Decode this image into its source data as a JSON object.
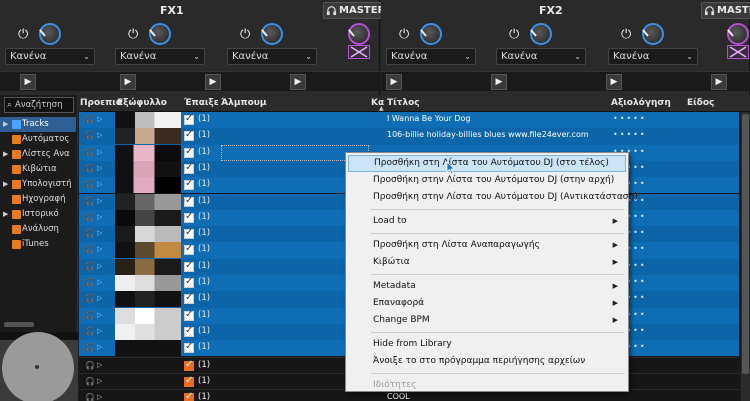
{
  "fx": [
    {
      "title": "FX1",
      "master_label": "MASTER",
      "slots": [
        {
          "effect": "Κανένα"
        },
        {
          "effect": "Κανένα"
        },
        {
          "effect": "Κανένα"
        }
      ]
    },
    {
      "title": "FX2",
      "master_label": "MASTER",
      "slots": [
        {
          "effect": "Κανένα"
        },
        {
          "effect": "Κανένα"
        },
        {
          "effect": "Κανένα"
        }
      ]
    }
  ],
  "sidebar": {
    "search_placeholder": "Αναζήτηση",
    "items": [
      {
        "label": "Tracks",
        "icon": "tracks-icon",
        "color": "#4da3ff",
        "active": true,
        "arrow": "▶"
      },
      {
        "label": "Αυτόματος",
        "icon": "autodj-icon",
        "color": "#e87a1f",
        "active": false,
        "arrow": ""
      },
      {
        "label": "Λίστες Ανα",
        "icon": "playlist-icon",
        "color": "#e87a1f",
        "active": false,
        "arrow": "▶"
      },
      {
        "label": "Κιβώτια",
        "icon": "crate-icon",
        "color": "#e87a1f",
        "active": false,
        "arrow": ""
      },
      {
        "label": "Υπολογιστή",
        "icon": "computer-icon",
        "color": "#e87a1f",
        "active": false,
        "arrow": "▶"
      },
      {
        "label": "Ηχογραφή",
        "icon": "record-icon",
        "color": "#e87a1f",
        "active": false,
        "arrow": ""
      },
      {
        "label": "Ιστορικό",
        "icon": "history-icon",
        "color": "#e87a1f",
        "active": false,
        "arrow": "▶"
      },
      {
        "label": "Ανάλυση",
        "icon": "analyze-icon",
        "color": "#e87a1f",
        "active": false,
        "arrow": ""
      },
      {
        "label": "iTunes",
        "icon": "itunes-icon",
        "color": "#e87a1f",
        "active": false,
        "arrow": ""
      }
    ]
  },
  "table": {
    "columns": {
      "preview": "Προεπισ",
      "cover": "Εξώφυλλο",
      "played": "Έπαιξε",
      "album": "Άλμπουμ",
      "ka": "Κα",
      "title": "Τίτλος",
      "rating": "Αξιολόγηση",
      "genre": "Είδος"
    },
    "rows": [
      {
        "played": "(1)",
        "title": "I Wanna Be Your Dog",
        "selected": true
      },
      {
        "played": "(1)",
        "title": "106-billie holiday-billies blues www.file24ever.com",
        "selected": true
      },
      {
        "played": "(1)",
        "title": "",
        "selected": true
      },
      {
        "played": "(1)",
        "title": "",
        "selected": true
      },
      {
        "played": "(1)",
        "title": "",
        "selected": true
      },
      {
        "played": "(1)",
        "title": "",
        "selected": true
      },
      {
        "played": "(1)",
        "title": "",
        "selected": true
      },
      {
        "played": "(1)",
        "title": "",
        "selected": true
      },
      {
        "played": "(1)",
        "title": "",
        "selected": true
      },
      {
        "played": "(1)",
        "title": "",
        "selected": true
      },
      {
        "played": "(1)",
        "title": "",
        "selected": true
      },
      {
        "played": "(1)",
        "title": "",
        "selected": true
      },
      {
        "played": "(1)",
        "title": "",
        "selected": true
      },
      {
        "played": "(1)",
        "title": "",
        "selected": true
      },
      {
        "played": "(1)",
        "title": "",
        "selected": true
      },
      {
        "played": "(1)",
        "title": "",
        "selected": false
      },
      {
        "played": "(1)",
        "title": "",
        "selected": false
      },
      {
        "played": "(1)",
        "title": "COOL",
        "selected": false
      }
    ]
  },
  "context_menu": {
    "items": [
      {
        "label": "Προσθήκη στη Λίστα του Αυτόματου DJ (στο τέλος)",
        "submenu": false,
        "hover": true,
        "disabled": false
      },
      {
        "label": "Προσθήκη στην Λίστα του Αυτόματου DJ (στην αρχή)",
        "submenu": false,
        "hover": false,
        "disabled": false
      },
      {
        "label": "Προσθήκη στην Λίστα του Αυτόματου DJ (Αντικατάσταση)",
        "submenu": false,
        "hover": false,
        "disabled": false
      },
      {
        "label": "Load to",
        "submenu": true,
        "hover": false,
        "disabled": false
      },
      {
        "label": "Προσθήκη στη Λίστα Αναπαραγωγής",
        "submenu": true,
        "hover": false,
        "disabled": false
      },
      {
        "label": "Κιβώτια",
        "submenu": true,
        "hover": false,
        "disabled": false
      },
      {
        "label": "Metadata",
        "submenu": true,
        "hover": false,
        "disabled": false
      },
      {
        "label": "Επαναφορά",
        "submenu": true,
        "hover": false,
        "disabled": false
      },
      {
        "label": "Change BPM",
        "submenu": true,
        "hover": false,
        "disabled": false
      },
      {
        "label": "Hide from Library",
        "submenu": false,
        "hover": false,
        "disabled": false
      },
      {
        "label": "Άνοιξε το στο πρόγραμμα περιήγησης αρχείων",
        "submenu": false,
        "hover": false,
        "disabled": false
      },
      {
        "label": "Ιδιότητες",
        "submenu": false,
        "hover": false,
        "disabled": true
      }
    ]
  },
  "colors": {
    "accent_blue": "#3d8fe6",
    "accent_purple": "#b64fd4",
    "selection": "#0e6db5",
    "orange": "#e86c1f"
  }
}
